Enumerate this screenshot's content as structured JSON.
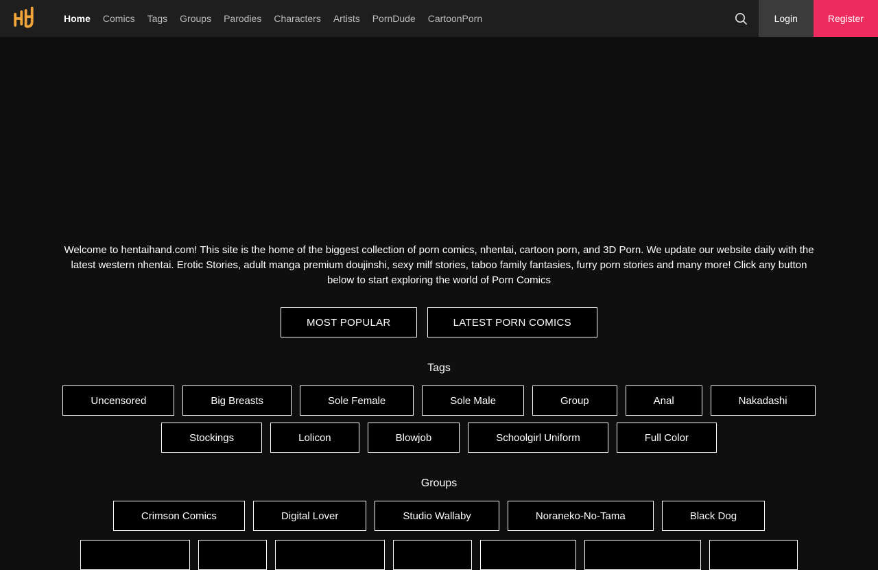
{
  "navbar": {
    "logo": "HH-monogram",
    "items": [
      "Home",
      "Comics",
      "Tags",
      "Groups",
      "Parodies",
      "Characters",
      "Artists",
      "PornDude",
      "CartoonPorn"
    ],
    "active_item": "Home",
    "search_icon": "magnifying-glass",
    "login_label": "Login",
    "register_label": "Register"
  },
  "intro": {
    "text": "Welcome to hentaihand.com! This site is the home of the biggest collection of porn comics, nhentai, cartoon porn, and 3D Porn. We update our website daily with the latest western nhentai. Erotic Stories, adult manga premium doujinshi, sexy milf stories, taboo family fantasies, furry porn stories and many more! Click any button below to start exploring the world of Porn Comics"
  },
  "cta": {
    "most_popular": "MOST POPULAR",
    "latest_comics": "LATEST PORN COMICS"
  },
  "tags": {
    "heading": "Tags",
    "row1": [
      "Uncensored",
      "Big Breasts",
      "Sole Female",
      "Sole Male",
      "Group",
      "Anal",
      "Nakadashi"
    ],
    "row2": [
      "Stockings",
      "Lolicon",
      "Blowjob",
      "Schoolgirl Uniform",
      "Full Color"
    ]
  },
  "groups": {
    "heading": "Groups",
    "row1": [
      "Crimson Comics",
      "Digital Lover",
      "Studio Wallaby",
      "Noraneko-No-Tama",
      "Black Dog"
    ],
    "partial_row_button_count": 7
  },
  "colors": {
    "accent_pink": "#ee2b5e",
    "logo_orange": "#f0a43a",
    "navbar_bg": "#1e1e1e",
    "login_bg": "#3b3b3b",
    "page_bg": "#0f0f0f",
    "button_border": "#ffffff"
  }
}
